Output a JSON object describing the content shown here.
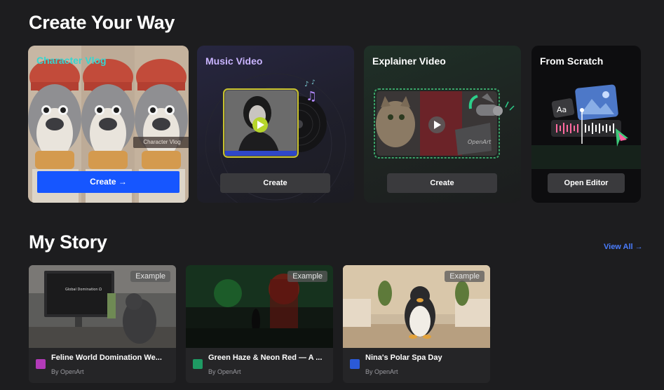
{
  "sections": {
    "create": "Create Your Way",
    "story": "My Story"
  },
  "cards": [
    {
      "title": "Character Vlog",
      "button": "Create →",
      "tag": "Character Vlog"
    },
    {
      "title": "Music Video",
      "button": "Create"
    },
    {
      "title": "Explainer Video",
      "button": "Create",
      "watermark": "OpenArt"
    },
    {
      "title": "From Scratch",
      "button": "Open Editor",
      "aa": "Aa"
    }
  ],
  "view_all": "View All →",
  "stories": [
    {
      "title": "Feline World Domination We...",
      "by": "By OpenArt",
      "badge": "Example",
      "icon": "video-icon",
      "icon_color": "#b23ab8",
      "screen_text": "Global Domination Ω"
    },
    {
      "title": "Green Haze & Neon Red — A ...",
      "by": "By OpenArt",
      "badge": "Example",
      "icon": "music-icon",
      "icon_color": "#1e9a63"
    },
    {
      "title": "Nina's Polar Spa Day",
      "by": "By OpenArt",
      "badge": "Example",
      "icon": "star-icon",
      "icon_color": "#2b5ad8"
    }
  ],
  "colors": {
    "background": "#1d1d1f",
    "primary_button": "#1656ff",
    "link": "#4a7dff",
    "vlog_title": "#36d6d1",
    "music_title": "#c9b4ff"
  }
}
